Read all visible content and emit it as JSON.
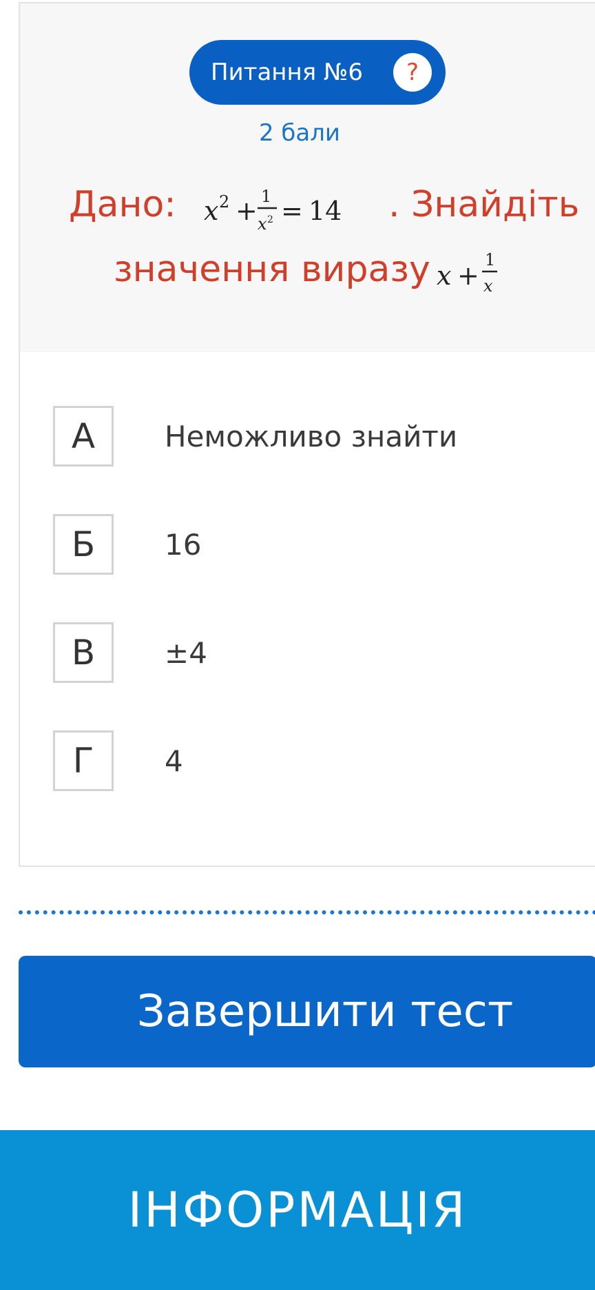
{
  "question": {
    "label": "Питання №6",
    "help_icon": "question-mark-icon",
    "help_glyph": "?",
    "points": "2 бали",
    "line1_prefix": "Дано:",
    "line1_suffix": ". Знайдіть",
    "line2_prefix": "значення виразу",
    "given_equation": "x² + 1/x² = 14",
    "target_expression": "x + 1/x",
    "colors": {
      "pill": "#0a5fc3",
      "question_text": "#cf3f2a",
      "points_text": "#1b74c4"
    }
  },
  "answers": [
    {
      "letter": "А",
      "text": "Неможливо знайти"
    },
    {
      "letter": "Б",
      "text": "16"
    },
    {
      "letter": "В",
      "text": "±4"
    },
    {
      "letter": "Г",
      "text": "4"
    }
  ],
  "actions": {
    "finish_label": "Завершити тест"
  },
  "footer": {
    "info_label": "ІНФОРМАЦІЯ",
    "color": "#0a90d4"
  }
}
